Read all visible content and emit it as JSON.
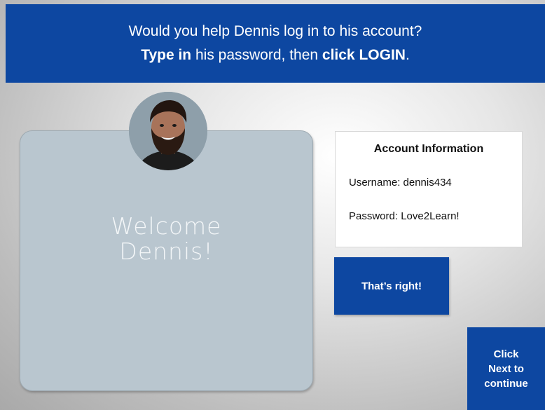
{
  "banner": {
    "line1": "Would you help Dennis log in to his account?",
    "line2_bold1": "Type in",
    "line2_mid": " his password, then ",
    "line2_bold2": "click LOGIN",
    "line2_end": "."
  },
  "card": {
    "welcome_line1": "Welcome",
    "welcome_line2": "Dennis!",
    "avatar": "user-avatar-photo"
  },
  "account_info": {
    "title": "Account Information",
    "username": "Username: dennis434",
    "password": "Password: Love2Learn!"
  },
  "buttons": {
    "thats_right": "That’s right!",
    "next_line1": "Click",
    "next_line2": "Next to",
    "next_line3": "continue"
  },
  "colors": {
    "accent": "#0d47a1",
    "card": "#b9c6cf"
  }
}
